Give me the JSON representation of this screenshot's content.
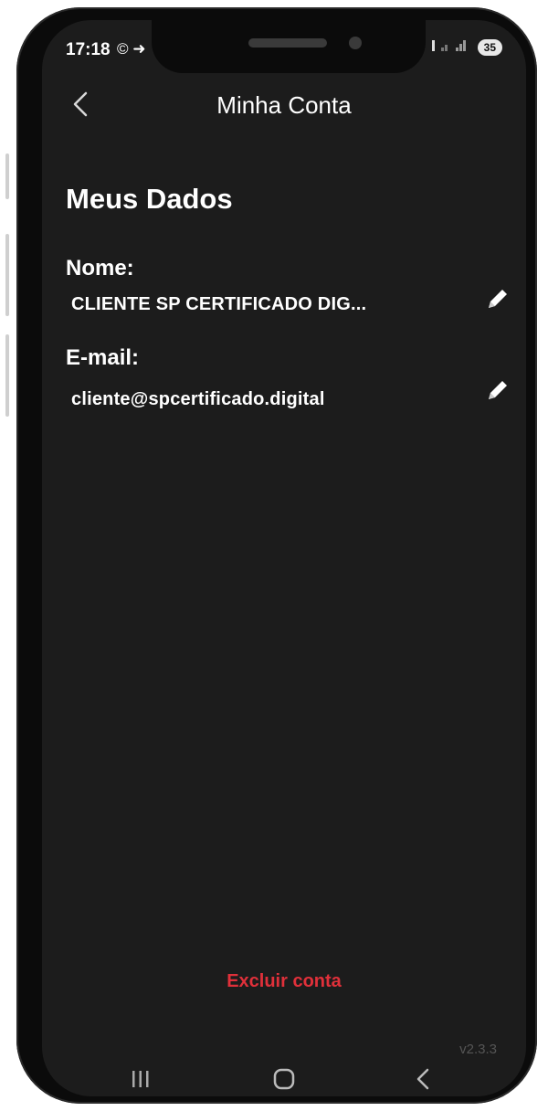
{
  "status_bar": {
    "time": "17:18",
    "left_icons": "© ➜",
    "battery": "35"
  },
  "header": {
    "title": "Minha Conta"
  },
  "section": {
    "title": "Meus Dados"
  },
  "fields": {
    "name_label": "Nome:",
    "name_value": "CLIENTE SP CERTIFICADO DIG...",
    "email_label": "E-mail:",
    "email_value": "cliente@spcertificado.digital"
  },
  "actions": {
    "delete_account": "Excluir conta"
  },
  "footer": {
    "version": "v2.3.3"
  },
  "icons": {
    "back": "chevron-left-icon",
    "edit": "pencil-icon",
    "nav_recent": "recent-apps-icon",
    "nav_home": "home-icon",
    "nav_back": "back-icon"
  },
  "colors": {
    "background": "#1c1c1c",
    "text": "#ffffff",
    "danger": "#e0303a"
  }
}
